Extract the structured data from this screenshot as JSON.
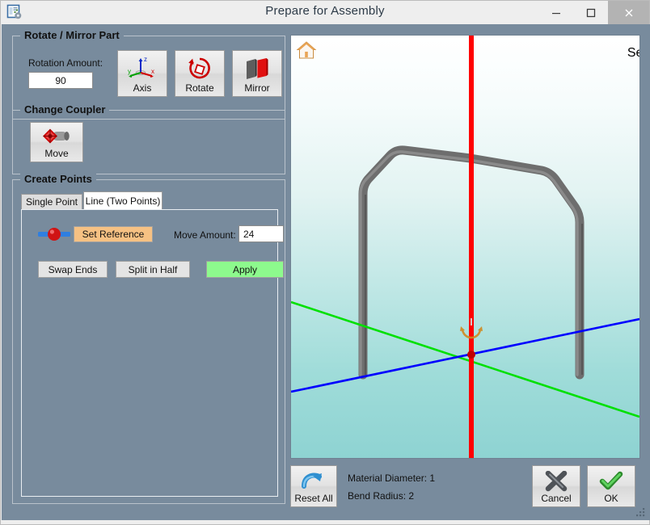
{
  "window": {
    "title": "Prepare for Assembly",
    "app_icon": "document-gear-icon",
    "minimize_label": "Minimize",
    "maximize_label": "Maximize",
    "close_label": "Close"
  },
  "rotate_mirror_group": {
    "title": "Rotate / Mirror Part",
    "rotation_amount_label": "Rotation Amount:",
    "rotation_amount_value": "90",
    "buttons": [
      {
        "label": "Axis",
        "icon": "axis-triad-icon"
      },
      {
        "label": "Rotate",
        "icon": "rotate-arrow-icon"
      },
      {
        "label": "Mirror",
        "icon": "mirror-planes-icon"
      }
    ]
  },
  "change_coupler_group": {
    "title": "Change Coupler",
    "move_button": {
      "label": "Move",
      "icon": "coupler-move-icon"
    }
  },
  "create_points_group": {
    "title": "Create Points",
    "tabs": [
      {
        "label": "Single Point",
        "active": false
      },
      {
        "label": "Line (Two Points)",
        "active": true
      }
    ],
    "endpoint_icon": "line-endpoint-icon",
    "set_reference_label": "Set Reference",
    "set_reference_color": "#f6c183",
    "move_amount_label": "Move Amount:",
    "move_amount_value": "24",
    "swap_ends_label": "Swap Ends",
    "split_in_half_label": "Split in Half",
    "apply_label": "Apply",
    "apply_color": "#8dfa8d"
  },
  "viewport": {
    "home_icon": "home-icon",
    "overlay_text": "Sel",
    "axes": {
      "x_axis_color": "#0000ff",
      "y_axis_color": "#00e000",
      "z_axis_color": "#ff0000",
      "origin_color": "#c00000",
      "anchor_icon": "rotation-anchor-icon"
    },
    "part": {
      "name": "bent-tube-part",
      "color": "#6e6e6e"
    }
  },
  "footer": {
    "reset_all_label": "Reset All",
    "reset_all_icon": "undo-arrow-icon",
    "material_diameter": "Material Diameter: 1",
    "bend_radius": "Bend Radius: 2",
    "cancel_label": "Cancel",
    "cancel_icon": "x-mark-icon",
    "ok_label": "OK",
    "ok_icon": "check-mark-icon",
    "resize_grip": "resize-grip-icon"
  }
}
